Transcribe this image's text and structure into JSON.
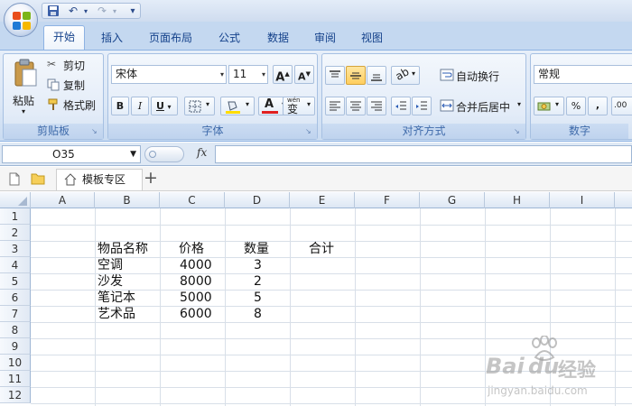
{
  "ribbon": {
    "tabs": [
      "开始",
      "插入",
      "页面布局",
      "公式",
      "数据",
      "审阅",
      "视图"
    ],
    "active_tab": "开始",
    "clipboard": {
      "paste": "粘贴",
      "cut": "剪切",
      "copy": "复制",
      "format_painter": "格式刷",
      "group_label": "剪贴板"
    },
    "font": {
      "font_name": "宋体",
      "font_size": "11",
      "grow": "A",
      "shrink": "A",
      "bold": "B",
      "italic": "I",
      "underline": "U",
      "font_color_glyph": "A",
      "phonetic_glyph": "wén",
      "group_label": "字体"
    },
    "alignment": {
      "wrap_text": "自动换行",
      "merge_center": "合并后居中",
      "group_label": "对齐方式"
    },
    "number": {
      "format": "常规",
      "percent": "%",
      "comma": ",",
      "decimal_glyph": ".00",
      "group_label": "数字"
    }
  },
  "formula_bar": {
    "name_box": "O35",
    "fx": "fx",
    "formula": ""
  },
  "doc_tabs": {
    "active": "模板专区",
    "add": "+"
  },
  "sheet": {
    "columns": [
      "A",
      "B",
      "C",
      "D",
      "E",
      "F",
      "G",
      "H",
      "I"
    ],
    "rows": [
      "1",
      "2",
      "3",
      "4",
      "5",
      "6",
      "7",
      "8",
      "9",
      "10",
      "11",
      "12"
    ],
    "header_row": {
      "name": "物品名称",
      "price": "价格",
      "qty": "数量",
      "total": "合计"
    },
    "items": [
      {
        "name": "空调",
        "price": "4000",
        "qty": "3"
      },
      {
        "name": "沙发",
        "price": "8000",
        "qty": "2"
      },
      {
        "name": "笔记本",
        "price": "5000",
        "qty": "5"
      },
      {
        "name": "艺术品",
        "price": "6000",
        "qty": "8"
      }
    ]
  },
  "watermark": {
    "brand_left": "Bai",
    "brand_right": "经验",
    "url": "jingyan.baidu.com"
  },
  "colors": {
    "accent": "#15428b",
    "ribbon_bg": "#dbe7f6",
    "font_red": "#e02020",
    "fill_yellow": "#ffdd00"
  }
}
